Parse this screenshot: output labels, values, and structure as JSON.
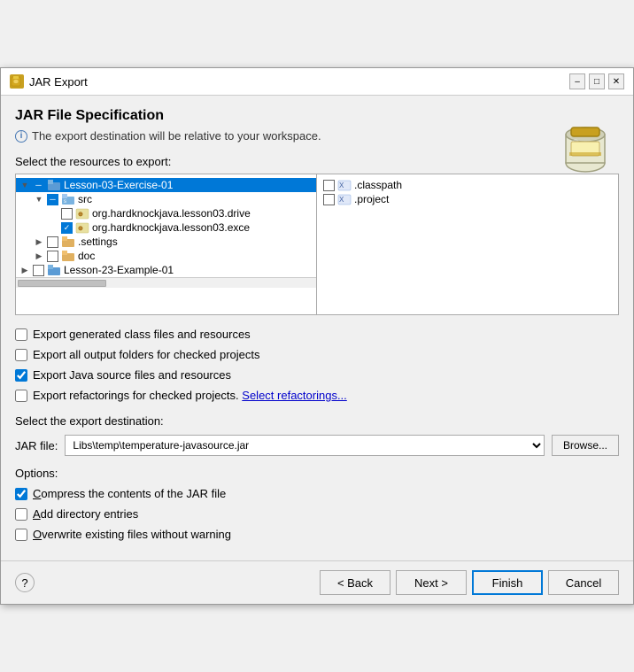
{
  "window": {
    "title": "JAR Export",
    "title_icon": "J"
  },
  "header": {
    "page_title": "JAR File Specification",
    "info_text": "The export destination will be relative to your workspace."
  },
  "resources_section": {
    "label": "Select the resources to export:",
    "tree_left": [
      {
        "level": 1,
        "expand": "v",
        "checkbox": "partial",
        "icon": "folder-blue",
        "label": "Lesson-03-Exercise-01",
        "selected": true
      },
      {
        "level": 2,
        "expand": "v",
        "checkbox": "partial",
        "icon": "folder-src",
        "label": "src"
      },
      {
        "level": 3,
        "expand": "",
        "checkbox": "unchecked",
        "icon": "pkg",
        "label": "org.hardknockjava.lesson03.drive"
      },
      {
        "level": 3,
        "expand": "",
        "checkbox": "checked",
        "icon": "pkg",
        "label": "org.hardknockjava.lesson03.exce"
      },
      {
        "level": 2,
        "expand": ">",
        "checkbox": "unchecked",
        "icon": "folder-settings",
        "label": ".settings"
      },
      {
        "level": 2,
        "expand": ">",
        "checkbox": "unchecked",
        "icon": "folder-doc",
        "label": "doc"
      },
      {
        "level": 1,
        "expand": ">",
        "checkbox": "unchecked",
        "icon": "folder-blue",
        "label": "Lesson-23-Example-01"
      }
    ],
    "tree_right": [
      {
        "checkbox": "unchecked",
        "icon": "file",
        "label": ".classpath"
      },
      {
        "checkbox": "unchecked",
        "icon": "file",
        "label": ".project"
      }
    ]
  },
  "export_options": [
    {
      "id": "opt1",
      "checked": false,
      "label": "Export generated class files and resources"
    },
    {
      "id": "opt2",
      "checked": false,
      "label": "Export all output folders for checked projects"
    },
    {
      "id": "opt3",
      "checked": true,
      "label": "Export Java source files and resources"
    },
    {
      "id": "opt4",
      "checked": false,
      "label": "Export refactorings for checked projects.",
      "link": "Select refactorings..."
    }
  ],
  "destination": {
    "label": "Select the export destination:",
    "jar_label": "JAR file:",
    "jar_value": "Libs\\temp\\temperature-javasource.jar",
    "browse_label": "Browse..."
  },
  "options": {
    "label": "Options:",
    "items": [
      {
        "id": "opt_compress",
        "checked": true,
        "label": "Compress the contents of the JAR file"
      },
      {
        "id": "opt_dir",
        "checked": false,
        "label": "Add directory entries"
      },
      {
        "id": "opt_overwrite",
        "checked": false,
        "label": "Overwrite existing files without warning"
      }
    ]
  },
  "buttons": {
    "back": "< Back",
    "next": "Next >",
    "finish": "Finish",
    "cancel": "Cancel"
  }
}
